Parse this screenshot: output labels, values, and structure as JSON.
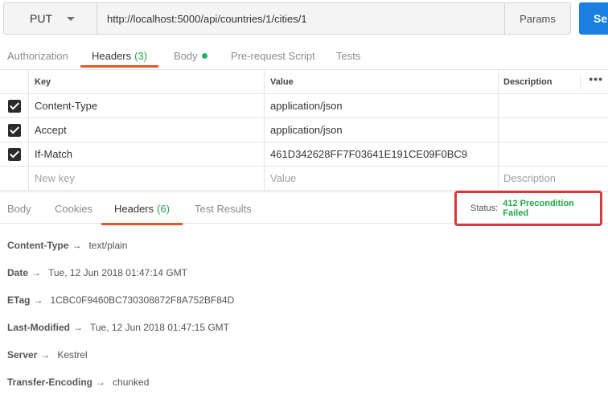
{
  "request": {
    "method": "PUT",
    "url": "http://localhost:5000/api/countries/1/cities/1",
    "params_label": "Params",
    "send_label": "Ser"
  },
  "request_tabs": [
    {
      "label": "Authorization"
    },
    {
      "label": "Headers",
      "count": "(3)"
    },
    {
      "label": "Body"
    },
    {
      "label": "Pre-request Script"
    },
    {
      "label": "Tests"
    }
  ],
  "headers_table": {
    "columns": {
      "key": "Key",
      "value": "Value",
      "description": "Description",
      "menu": "•••"
    },
    "rows": [
      {
        "key": "Content-Type",
        "value": "application/json",
        "checked": true
      },
      {
        "key": "Accept",
        "value": "application/json",
        "checked": true
      },
      {
        "key": "If-Match",
        "value": "461D342628FF7F03641E191CE09F0BC9",
        "checked": true
      }
    ],
    "new_row": {
      "key_placeholder": "New key",
      "value_placeholder": "Value",
      "description_placeholder": "Description"
    }
  },
  "response_tabs": [
    {
      "label": "Body"
    },
    {
      "label": "Cookies"
    },
    {
      "label": "Headers",
      "count": "(6)"
    },
    {
      "label": "Test Results"
    }
  ],
  "status": {
    "label": "Status:",
    "value": "412 Precondition Failed"
  },
  "response_headers": [
    {
      "key": "Content-Type",
      "value": "text/plain"
    },
    {
      "key": "Date",
      "value": "Tue, 12 Jun 2018 01:47:14 GMT"
    },
    {
      "key": "ETag",
      "value": "1CBC0F9460BC730308872F8A752BF84D"
    },
    {
      "key": "Last-Modified",
      "value": "Tue, 12 Jun 2018 01:47:15 GMT"
    },
    {
      "key": "Server",
      "value": "Kestrel"
    },
    {
      "key": "Transfer-Encoding",
      "value": "chunked"
    }
  ],
  "arrow_glyph": "→",
  "colors": {
    "accent": "#e0592a",
    "send": "#1a7fe0",
    "success": "#1fa64a",
    "highlight": "#d9383d"
  }
}
